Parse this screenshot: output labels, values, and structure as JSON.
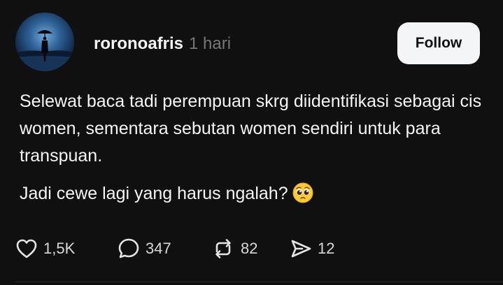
{
  "post": {
    "username": "roronoafris",
    "timestamp": "1 hari",
    "follow_label": "Follow",
    "paragraphs": [
      "Selewat baca tadi perempuan skrg diidentifikasi sebagai cis women, sementara sebutan women sendiri untuk para transpuan.",
      "Jadi cewe lagi yang harus ngalah?"
    ],
    "emoji": "pleading-face-emoji",
    "actions": {
      "likes": "1,5K",
      "replies": "347",
      "reposts": "82",
      "shares": "12"
    }
  },
  "icons": {
    "like": "heart-icon",
    "reply": "comment-icon",
    "repost": "repost-icon",
    "share": "send-icon"
  },
  "colors": {
    "background": "#101010",
    "text": "#f3f5f7",
    "muted": "#777777",
    "button_bg": "#f3f5f7",
    "button_text": "#101010"
  }
}
